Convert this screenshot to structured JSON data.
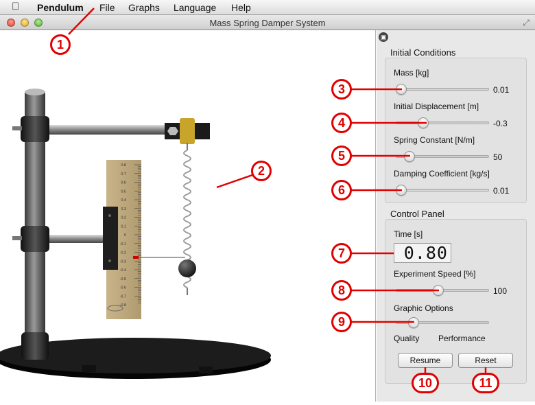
{
  "menubar": {
    "app_name": "Pendulum",
    "items": [
      "File",
      "Graphs",
      "Language",
      "Help"
    ]
  },
  "window": {
    "title": "Mass Spring Damper System"
  },
  "scene": {
    "ruler_ticks": [
      "0.8",
      "0.7",
      "0.6",
      "0.5",
      "0.4",
      "0.3",
      "0.2",
      "0.1",
      "0",
      "-0.1",
      "-0.2",
      "-0.3",
      "-0.4",
      "-0.5",
      "-0.6",
      "-0.7",
      "-0.8"
    ]
  },
  "initial_conditions": {
    "title": "Initial Conditions",
    "mass": {
      "label": "Mass [kg]",
      "value": "0.01",
      "level": 0.0
    },
    "displacement": {
      "label": "Initial Displacement [m]",
      "value": "-0.3",
      "level": 0.27
    },
    "spring_constant": {
      "label": "Spring Constant [N/m]",
      "value": "50",
      "level": 0.1
    },
    "damping": {
      "label": "Damping Coefficient [kg/s]",
      "value": "0.01",
      "level": 0.0
    }
  },
  "control_panel": {
    "title": "Control Panel",
    "time_label": "Time [s]",
    "time_value": "0.80",
    "speed": {
      "label": "Experiment Speed [%]",
      "value": "100",
      "level": 0.45
    },
    "graphic_options": {
      "label": "Graphic Options",
      "left": "Quality",
      "right": "Performance",
      "level": 0.15
    },
    "resume_label": "Resume",
    "reset_label": "Reset"
  },
  "callouts": [
    "1",
    "2",
    "3",
    "4",
    "5",
    "6",
    "7",
    "8",
    "9",
    "10",
    "11"
  ],
  "colors": {
    "callout": "#e00000",
    "stand": "#555555",
    "base": "#111111"
  }
}
